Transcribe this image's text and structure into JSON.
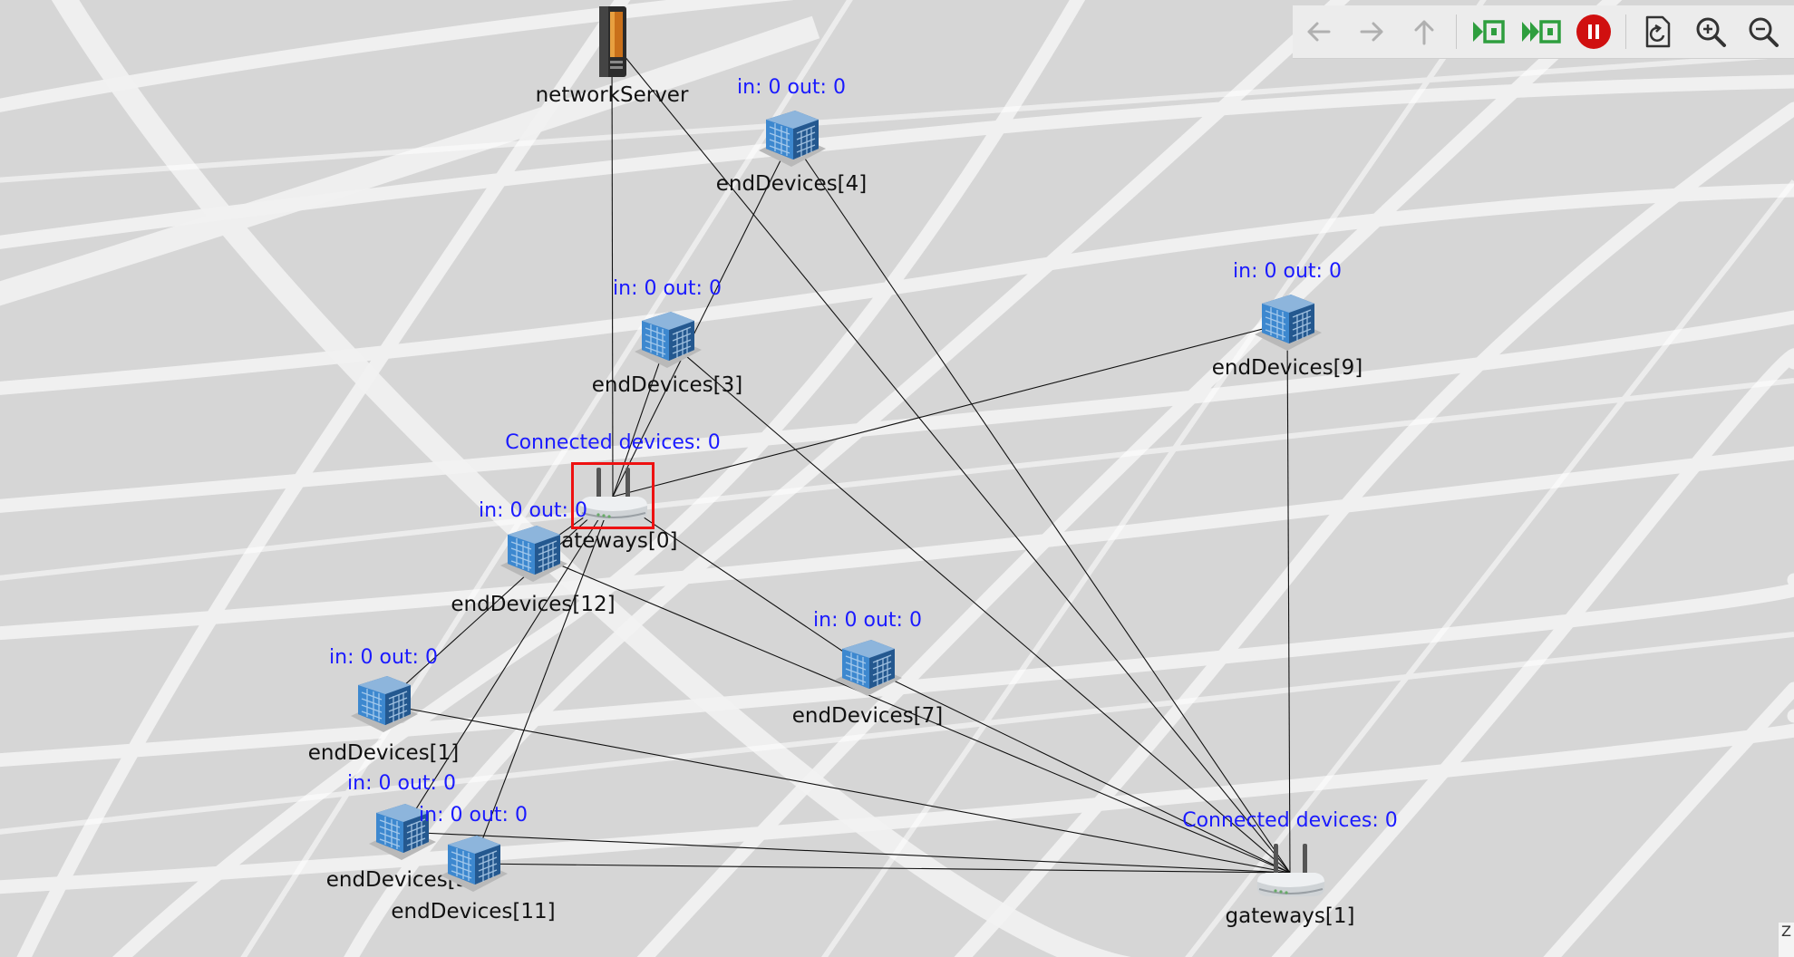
{
  "toolbar": {
    "buttons": [
      {
        "name": "back-button",
        "icon": "arrow-left-icon",
        "enabled": false
      },
      {
        "name": "forward-button",
        "icon": "arrow-right-icon",
        "enabled": false
      },
      {
        "name": "parent-button",
        "icon": "arrow-up-icon",
        "enabled": false
      },
      {
        "name": "run-button",
        "icon": "play-next-event-icon",
        "enabled": true
      },
      {
        "name": "fast-run-button",
        "icon": "fast-forward-icon",
        "enabled": true
      },
      {
        "name": "stop-button",
        "icon": "pause-icon",
        "enabled": true
      },
      {
        "name": "refresh-button",
        "icon": "redraw-icon",
        "enabled": true
      },
      {
        "name": "zoom-in-button",
        "icon": "zoom-in-icon",
        "enabled": true
      },
      {
        "name": "zoom-out-button",
        "icon": "zoom-out-icon",
        "enabled": true
      }
    ]
  },
  "colors": {
    "status_text": "#1a1aff",
    "selection": "#e11111",
    "run_green": "#2e9e3e",
    "stop_red": "#d01010"
  },
  "nodes": {
    "networkServer": {
      "label": "networkServer",
      "icon": "server-icon"
    },
    "endDevices4": {
      "label": "endDevices[4]",
      "status": "in: 0 out: 0",
      "icon": "building-icon"
    },
    "endDevices3": {
      "label": "endDevices[3]",
      "status": "in: 0 out: 0",
      "icon": "building-icon"
    },
    "endDevices9": {
      "label": "endDevices[9]",
      "status": "in: 0 out: 0",
      "icon": "building-icon"
    },
    "gateways0": {
      "label": "gateways[0]",
      "status": "Connected devices: 0",
      "icon": "router-icon",
      "selected": true
    },
    "endDevices12": {
      "label": "endDevices[12]",
      "status": "in: 0 out: 0",
      "icon": "building-icon"
    },
    "endDevices7": {
      "label": "endDevices[7]",
      "status": "in: 0 out: 0",
      "icon": "building-icon"
    },
    "endDevices1": {
      "label": "endDevices[1]",
      "status": "in: 0 out: 0",
      "icon": "building-icon"
    },
    "endDevices5": {
      "label": "endDevices[5]",
      "status": "in: 0 out: 0",
      "icon": "building-icon"
    },
    "endDevices11": {
      "label": "endDevices[11]",
      "status": "in: 0 out: 0",
      "icon": "building-icon"
    },
    "gateways1": {
      "label": "gateways[1]",
      "status": "Connected devices: 0",
      "icon": "router-icon"
    }
  },
  "connections": [
    [
      "networkServer",
      "gateways0"
    ],
    [
      "networkServer",
      "gateways1"
    ],
    [
      "endDevices4",
      "gateways0"
    ],
    [
      "endDevices4",
      "gateways1"
    ],
    [
      "endDevices3",
      "gateways0"
    ],
    [
      "endDevices3",
      "gateways1"
    ],
    [
      "endDevices9",
      "gateways0"
    ],
    [
      "endDevices9",
      "gateways1"
    ],
    [
      "endDevices12",
      "gateways0"
    ],
    [
      "endDevices12",
      "gateways1"
    ],
    [
      "endDevices7",
      "gateways0"
    ],
    [
      "endDevices7",
      "gateways1"
    ],
    [
      "endDevices1",
      "gateways0"
    ],
    [
      "endDevices1",
      "gateways1"
    ],
    [
      "endDevices5",
      "gateways0"
    ],
    [
      "endDevices5",
      "gateways1"
    ],
    [
      "endDevices11",
      "gateways0"
    ],
    [
      "endDevices11",
      "gateways1"
    ]
  ],
  "corner_text": "Z"
}
